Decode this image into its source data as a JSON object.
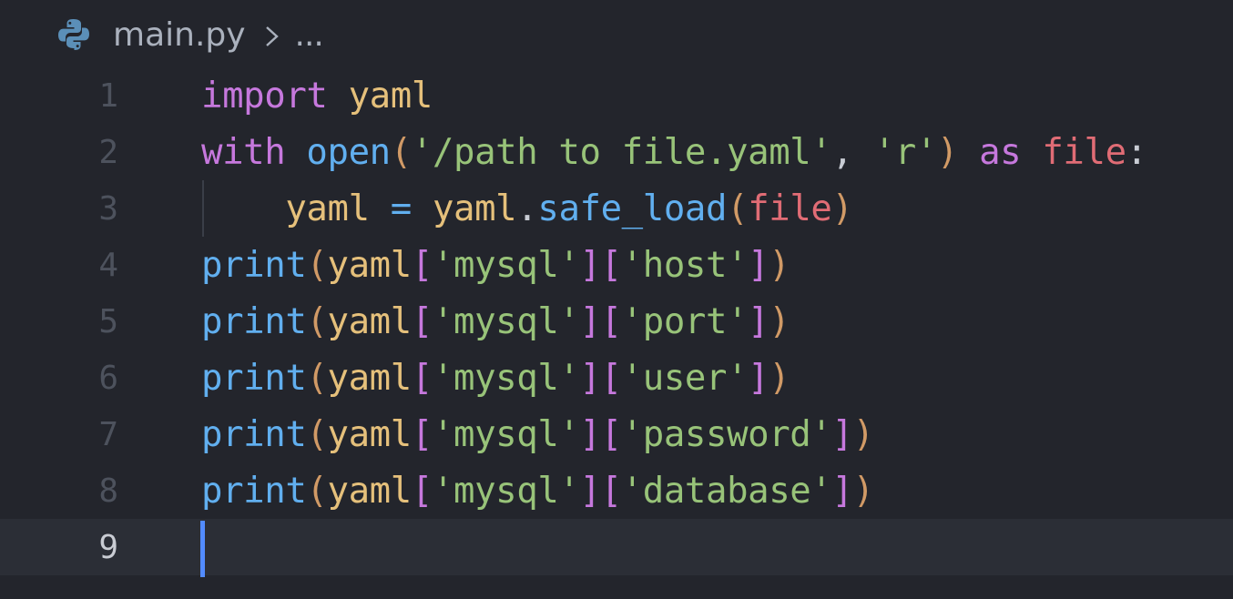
{
  "breadcrumb": {
    "file_icon": "python-icon",
    "separator_icon": "chevron-right-icon",
    "file_name": "main.py",
    "ellipsis": "..."
  },
  "current_line": 9,
  "lines": [
    {
      "number": "1",
      "tokens": [
        {
          "text": "import",
          "type": "kw"
        },
        {
          "text": " ",
          "type": "plain"
        },
        {
          "text": "yaml",
          "type": "var"
        }
      ]
    },
    {
      "number": "2",
      "tokens": [
        {
          "text": "with",
          "type": "kw"
        },
        {
          "text": " ",
          "type": "plain"
        },
        {
          "text": "open",
          "type": "fn"
        },
        {
          "text": "(",
          "type": "p1"
        },
        {
          "text": "'/path to file.yaml'",
          "type": "str"
        },
        {
          "text": ", ",
          "type": "plain"
        },
        {
          "text": "'r'",
          "type": "str"
        },
        {
          "text": ")",
          "type": "p1"
        },
        {
          "text": " ",
          "type": "plain"
        },
        {
          "text": "as",
          "type": "kw"
        },
        {
          "text": " ",
          "type": "plain"
        },
        {
          "text": "file",
          "type": "param"
        },
        {
          "text": ":",
          "type": "plain"
        }
      ]
    },
    {
      "number": "3",
      "tokens": [
        {
          "text": "    ",
          "type": "plain"
        },
        {
          "text": "yaml",
          "type": "var"
        },
        {
          "text": " ",
          "type": "plain"
        },
        {
          "text": "=",
          "type": "fn"
        },
        {
          "text": " ",
          "type": "plain"
        },
        {
          "text": "yaml",
          "type": "var"
        },
        {
          "text": ".",
          "type": "plain"
        },
        {
          "text": "safe_load",
          "type": "fn"
        },
        {
          "text": "(",
          "type": "p1"
        },
        {
          "text": "file",
          "type": "param"
        },
        {
          "text": ")",
          "type": "p1"
        }
      ]
    },
    {
      "number": "4",
      "tokens": [
        {
          "text": "print",
          "type": "fn"
        },
        {
          "text": "(",
          "type": "p1"
        },
        {
          "text": "yaml",
          "type": "var"
        },
        {
          "text": "[",
          "type": "p2"
        },
        {
          "text": "'mysql'",
          "type": "str"
        },
        {
          "text": "]",
          "type": "p2"
        },
        {
          "text": "[",
          "type": "p2"
        },
        {
          "text": "'host'",
          "type": "str"
        },
        {
          "text": "]",
          "type": "p2"
        },
        {
          "text": ")",
          "type": "p1"
        }
      ]
    },
    {
      "number": "5",
      "tokens": [
        {
          "text": "print",
          "type": "fn"
        },
        {
          "text": "(",
          "type": "p1"
        },
        {
          "text": "yaml",
          "type": "var"
        },
        {
          "text": "[",
          "type": "p2"
        },
        {
          "text": "'mysql'",
          "type": "str"
        },
        {
          "text": "]",
          "type": "p2"
        },
        {
          "text": "[",
          "type": "p2"
        },
        {
          "text": "'port'",
          "type": "str"
        },
        {
          "text": "]",
          "type": "p2"
        },
        {
          "text": ")",
          "type": "p1"
        }
      ]
    },
    {
      "number": "6",
      "tokens": [
        {
          "text": "print",
          "type": "fn"
        },
        {
          "text": "(",
          "type": "p1"
        },
        {
          "text": "yaml",
          "type": "var"
        },
        {
          "text": "[",
          "type": "p2"
        },
        {
          "text": "'mysql'",
          "type": "str"
        },
        {
          "text": "]",
          "type": "p2"
        },
        {
          "text": "[",
          "type": "p2"
        },
        {
          "text": "'user'",
          "type": "str"
        },
        {
          "text": "]",
          "type": "p2"
        },
        {
          "text": ")",
          "type": "p1"
        }
      ]
    },
    {
      "number": "7",
      "tokens": [
        {
          "text": "print",
          "type": "fn"
        },
        {
          "text": "(",
          "type": "p1"
        },
        {
          "text": "yaml",
          "type": "var"
        },
        {
          "text": "[",
          "type": "p2"
        },
        {
          "text": "'mysql'",
          "type": "str"
        },
        {
          "text": "]",
          "type": "p2"
        },
        {
          "text": "[",
          "type": "p2"
        },
        {
          "text": "'password'",
          "type": "str"
        },
        {
          "text": "]",
          "type": "p2"
        },
        {
          "text": ")",
          "type": "p1"
        }
      ]
    },
    {
      "number": "8",
      "tokens": [
        {
          "text": "print",
          "type": "fn"
        },
        {
          "text": "(",
          "type": "p1"
        },
        {
          "text": "yaml",
          "type": "var"
        },
        {
          "text": "[",
          "type": "p2"
        },
        {
          "text": "'mysql'",
          "type": "str"
        },
        {
          "text": "]",
          "type": "p2"
        },
        {
          "text": "[",
          "type": "p2"
        },
        {
          "text": "'database'",
          "type": "str"
        },
        {
          "text": "]",
          "type": "p2"
        },
        {
          "text": ")",
          "type": "p1"
        }
      ]
    },
    {
      "number": "9",
      "tokens": []
    }
  ],
  "colors": {
    "background": "#23252c",
    "current_line": "#2b2e36",
    "keyword": "#c678dd",
    "function": "#61afef",
    "variable": "#e5c07b",
    "string": "#98c379",
    "parameter": "#e06c75",
    "caret": "#528bff"
  }
}
